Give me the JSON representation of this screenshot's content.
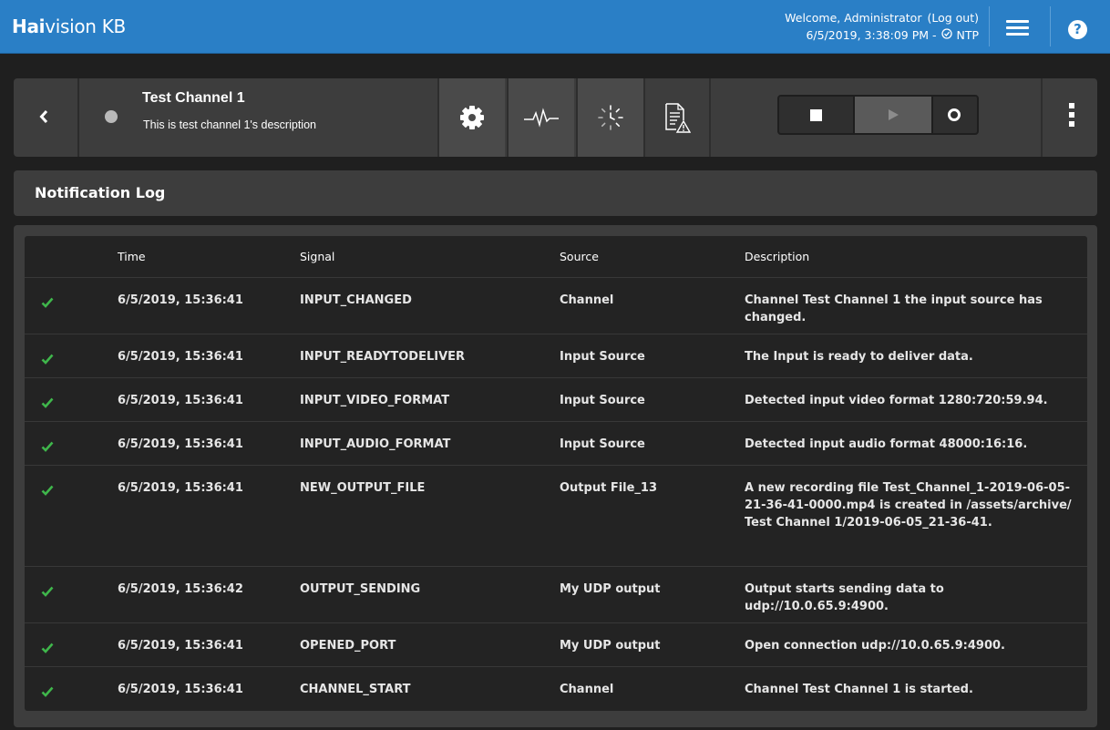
{
  "header": {
    "brand_bold": "Hai",
    "brand_rest": "vision KB",
    "welcome": "Welcome, Administrator",
    "logout_label": "(Log out)",
    "datetime": "6/5/2019, 3:38:09 PM - ",
    "ntp_label": "NTP",
    "icons": [
      "menu-icon",
      "help-icon"
    ]
  },
  "channel": {
    "title": "Test Channel 1",
    "description": "This is test channel 1's description",
    "status_color": "#b9b9b9",
    "toolbar_icons": [
      "gear-icon",
      "signal-icon",
      "loading-icon",
      "report-warning-icon"
    ],
    "transport_icons": [
      "stop-icon",
      "play-icon",
      "record-icon"
    ]
  },
  "section": {
    "title": "Notification Log"
  },
  "log": {
    "columns": [
      "Time",
      "Signal",
      "Source",
      "Description"
    ],
    "rows": [
      {
        "time": "6/5/2019, 15:36:41",
        "signal": "INPUT_CHANGED",
        "source": "Channel",
        "description": "Channel Test Channel 1 the input source has changed."
      },
      {
        "time": "6/5/2019, 15:36:41",
        "signal": "INPUT_READYTODELIVER",
        "source": "Input Source",
        "description": "The Input is ready to deliver data."
      },
      {
        "time": "6/5/2019, 15:36:41",
        "signal": "INPUT_VIDEO_FORMAT",
        "source": "Input Source",
        "description": "Detected input video format 1280:720:59.94."
      },
      {
        "time": "6/5/2019, 15:36:41",
        "signal": "INPUT_AUDIO_FORMAT",
        "source": "Input Source",
        "description": "Detected input audio format 48000:16:16."
      },
      {
        "time": "6/5/2019, 15:36:41",
        "signal": "NEW_OUTPUT_FILE",
        "source": "Output File_13",
        "description": "A new recording file Test_Channel_1-2019-06-05-21-36-41-0000.mp4 is created in /assets/archive/Test Channel 1/2019-06-05_21-36-41."
      },
      {
        "time": "6/5/2019, 15:36:42",
        "signal": "OUTPUT_SENDING",
        "source": "My UDP output",
        "description": "Output starts sending data to udp://10.0.65.9:4900."
      },
      {
        "time": "6/5/2019, 15:36:41",
        "signal": "OPENED_PORT",
        "source": "My UDP output",
        "description": "Open connection udp://10.0.65.9:4900."
      },
      {
        "time": "6/5/2019, 15:36:41",
        "signal": "CHANNEL_START",
        "source": "Channel",
        "description": "Channel Test Channel 1 is started."
      }
    ],
    "status_icon": "check-icon",
    "status_color": "#3fb64b"
  }
}
